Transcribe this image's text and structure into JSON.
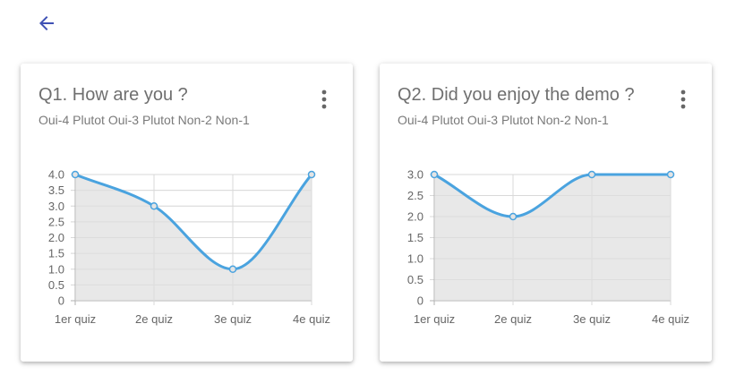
{
  "header": {
    "back_icon": "arrow-left-icon",
    "accent_color": "#3f51b5"
  },
  "cards": [
    {
      "title": "Q1. How are you ?",
      "subtitle": "Oui-4 Plutot Oui-3 Plutot Non-2 Non-1",
      "menu_icon": "more-vertical-icon"
    },
    {
      "title": "Q2. Did you enjoy the demo ?",
      "subtitle": "Oui-4 Plutot Oui-3 Plutot Non-2 Non-1",
      "menu_icon": "more-vertical-icon"
    }
  ],
  "chart_data": [
    {
      "type": "area",
      "categories": [
        "1er quiz",
        "2e quiz",
        "3e quiz",
        "4e quiz"
      ],
      "values": [
        4,
        3,
        1,
        4
      ],
      "ylim": [
        0,
        4
      ],
      "yticks": [
        "0",
        "0.5",
        "1.0",
        "1.5",
        "2.0",
        "2.5",
        "3.0",
        "3.5",
        "4.0"
      ],
      "grid": true,
      "line_color": "#4aa3df",
      "fill_color": "#e4e4e4"
    },
    {
      "type": "area",
      "categories": [
        "1er quiz",
        "2e quiz",
        "3e quiz",
        "4e quiz"
      ],
      "values": [
        3,
        2,
        3,
        3
      ],
      "ylim": [
        0,
        3
      ],
      "yticks": [
        "0",
        "0.5",
        "1.0",
        "1.5",
        "2.0",
        "2.5",
        "3.0"
      ],
      "grid": true,
      "line_color": "#4aa3df",
      "fill_color": "#e4e4e4"
    }
  ]
}
